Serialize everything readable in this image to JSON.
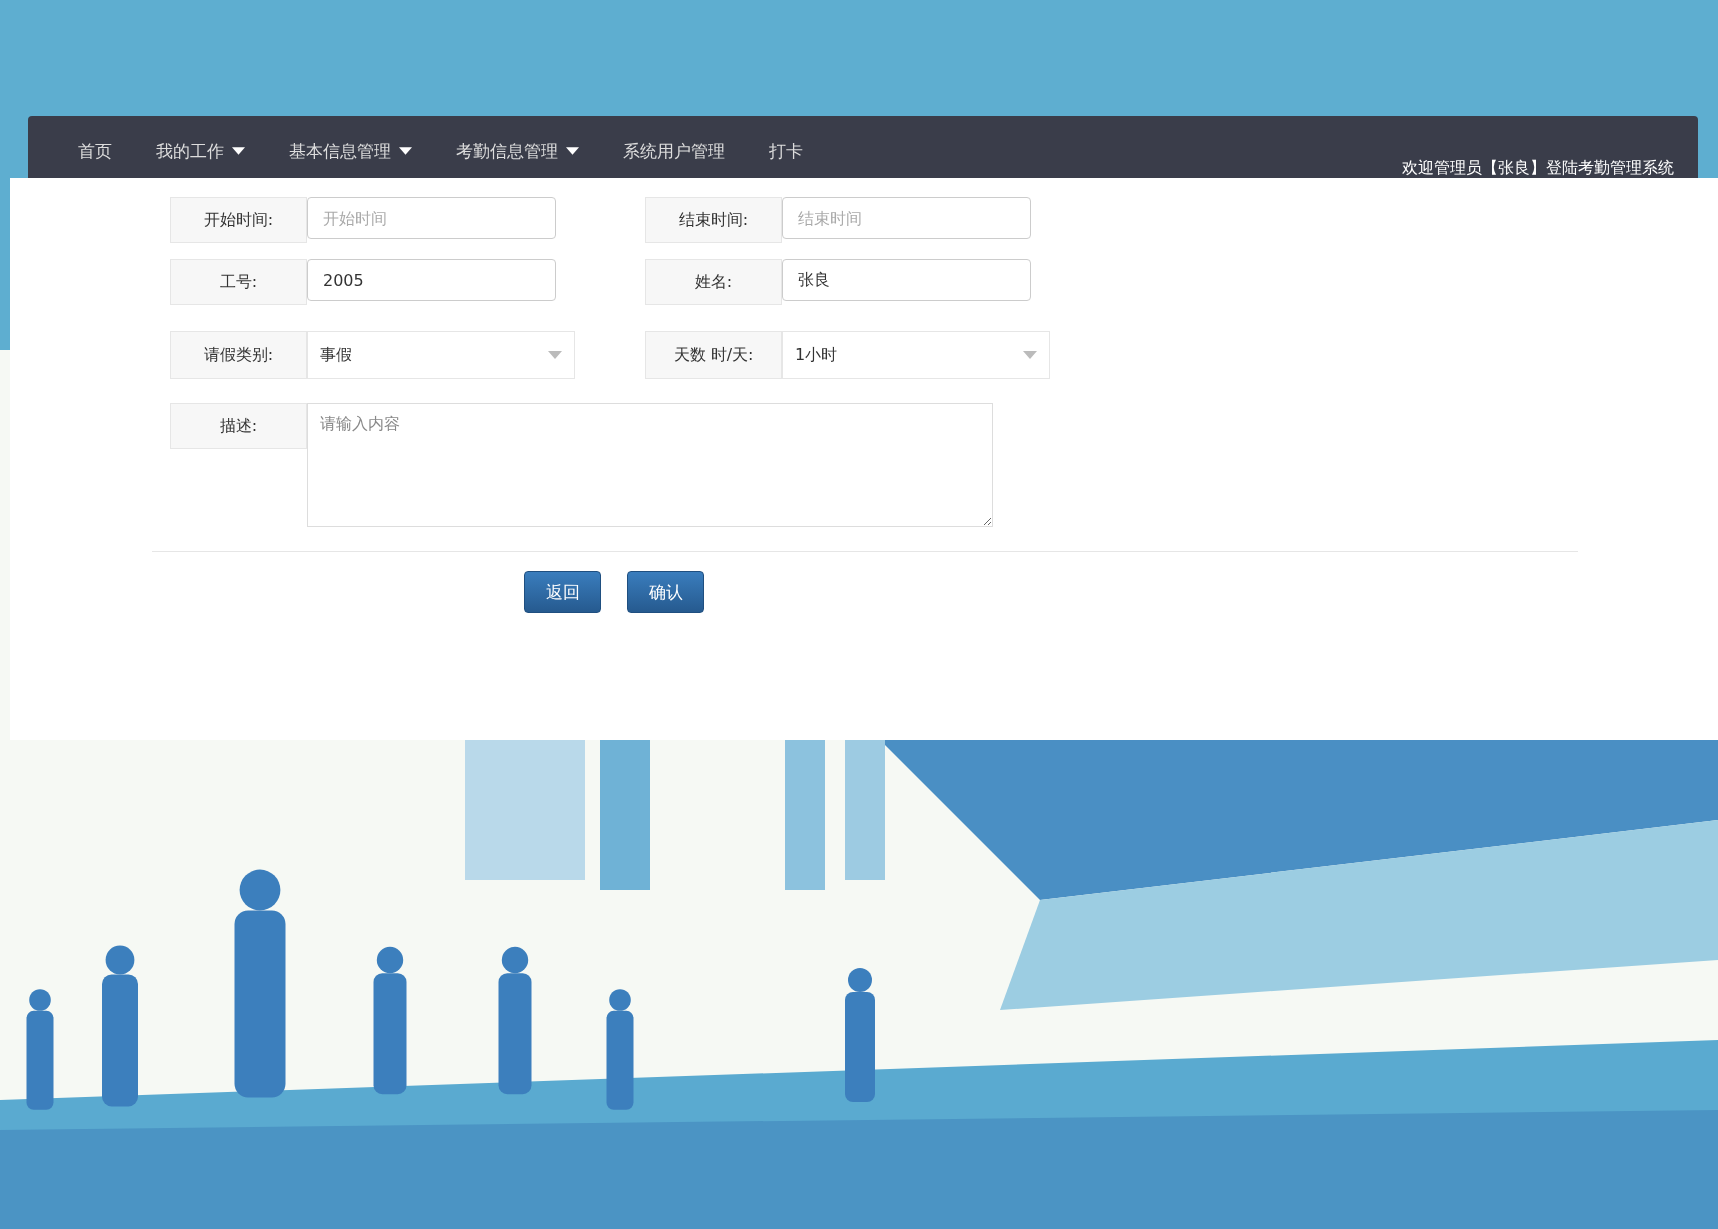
{
  "nav": {
    "items": [
      {
        "label": "首页",
        "dropdown": false
      },
      {
        "label": "我的工作",
        "dropdown": true
      },
      {
        "label": "基本信息管理",
        "dropdown": true
      },
      {
        "label": "考勤信息管理",
        "dropdown": true
      },
      {
        "label": "系统用户管理",
        "dropdown": false
      },
      {
        "label": "打卡",
        "dropdown": false
      }
    ],
    "welcome": "欢迎管理员【张良】登陆考勤管理系统"
  },
  "form": {
    "rows": [
      [
        {
          "kind": "input",
          "label": "开始时间:",
          "placeholder": "开始时间"
        },
        {
          "kind": "input",
          "label": "结束时间:",
          "placeholder": "结束时间"
        }
      ],
      [
        {
          "kind": "input",
          "label": "工号:",
          "value": "2005"
        },
        {
          "kind": "input",
          "label": "姓名:",
          "value": "张良"
        }
      ],
      [
        {
          "kind": "select",
          "label": "请假类别:",
          "value": "事假"
        },
        {
          "kind": "select",
          "label": "天数 时/天:",
          "value": "1小时"
        }
      ],
      [
        {
          "kind": "textarea",
          "label": "描述:",
          "placeholder": "请输入内容"
        }
      ]
    ]
  },
  "buttons": [
    "返回",
    "确认"
  ]
}
